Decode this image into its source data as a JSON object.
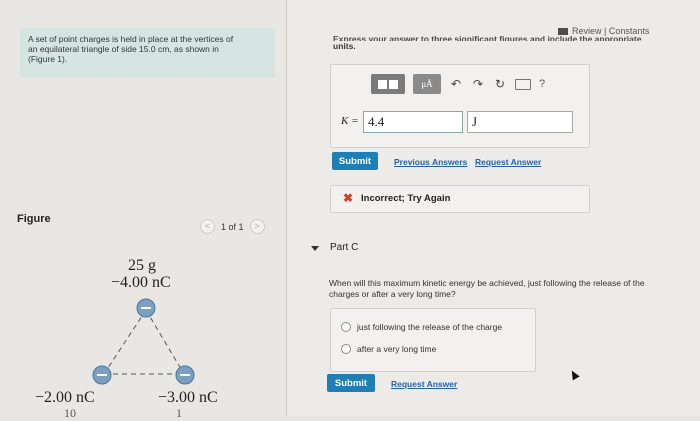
{
  "problem": {
    "line1": "A set of point charges is held in place at the vertices of",
    "line2": "an equilateral triangle of side 15.0 cm, as shown in",
    "line3": "(Figure 1)."
  },
  "figure": {
    "label": "Figure",
    "pager_text": "1 of 1",
    "prev_glyph": "<",
    "next_glyph": ">",
    "top_mass": "25 g",
    "top_charge": "−4.00 nC",
    "left_charge": "−2.00 nC",
    "right_charge": "−3.00 nC",
    "cut_left": "10",
    "cut_right": "1"
  },
  "header": {
    "review_text": "Review | Constants",
    "express_line1": "Express your answer to three significant figures and include the appropriate",
    "express_line2": "units."
  },
  "toolbar": {
    "mu_label": "μÅ",
    "undo": "↶",
    "redo": "↷",
    "reset": "↻",
    "help": "?"
  },
  "answer": {
    "k_label": "K =",
    "value": "4.4",
    "unit": "J"
  },
  "actions": {
    "submit": "Submit",
    "previous_answers": "Previous Answers",
    "request_answer": "Request Answer"
  },
  "feedback": {
    "text": "Incorrect; Try Again"
  },
  "part_c": {
    "title": "Part C",
    "question": "When will this maximum kinetic energy be achieved, just following the release of the charges or after a very long time?",
    "options": [
      "just following the release of the charge",
      "after a very long time"
    ],
    "submit": "Submit",
    "request_answer": "Request Answer"
  },
  "colors": {
    "accent": "#1f7fb4",
    "error": "#d2412b",
    "charge_blue": "#7a9fc0"
  }
}
